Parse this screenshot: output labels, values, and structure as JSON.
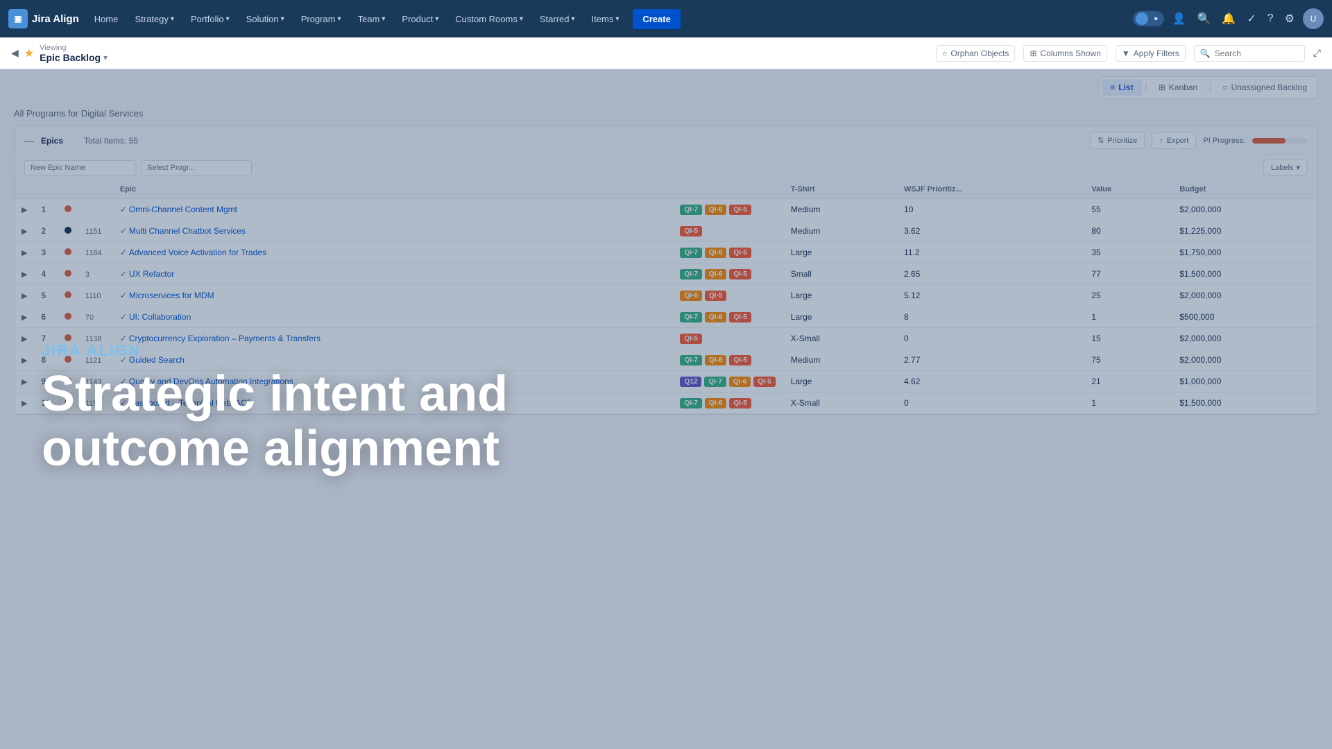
{
  "app": {
    "name": "Jira Align",
    "logo_letter": "JA"
  },
  "nav": {
    "items": [
      {
        "label": "Home",
        "has_dropdown": false
      },
      {
        "label": "Strategy",
        "has_dropdown": true
      },
      {
        "label": "Portfolio",
        "has_dropdown": true
      },
      {
        "label": "Solution",
        "has_dropdown": true
      },
      {
        "label": "Program",
        "has_dropdown": true
      },
      {
        "label": "Team",
        "has_dropdown": true
      },
      {
        "label": "Product",
        "has_dropdown": true
      },
      {
        "label": "Custom Rooms",
        "has_dropdown": true
      },
      {
        "label": "Starred",
        "has_dropdown": true
      },
      {
        "label": "Items",
        "has_dropdown": true
      }
    ],
    "create_label": "Create"
  },
  "subbar": {
    "viewing_label": "Viewing",
    "title": "Epic Backlog",
    "buttons": {
      "orphan_objects": "Orphan Objects",
      "columns_shown": "Columns Shown",
      "apply_filters": "Apply Filters",
      "search_placeholder": "Search"
    }
  },
  "view_tabs": [
    {
      "label": "List",
      "icon": "≡",
      "active": true
    },
    {
      "label": "Kanban",
      "icon": "⊞",
      "active": false
    },
    {
      "label": "Unassigned Backlog",
      "icon": "○",
      "active": false
    }
  ],
  "program": {
    "title": "All Programs for Digital Services"
  },
  "table": {
    "epics_label": "Epics",
    "total_items": "Total Items: 55",
    "new_epic_placeholder": "New Epic Name",
    "product_program_placeholder": "Select Progr...",
    "pi_progress_label": "PI Progress:",
    "prioritize_label": "Prioritize",
    "export_label": "Export",
    "labels_label": "Labels",
    "columns": [
      "",
      "",
      "",
      "",
      "Epic",
      "",
      "T-Shirt",
      "WSJF Prioritiz...",
      "Value",
      "Budget"
    ],
    "rows": [
      {
        "num": 1,
        "dot_color": "#e05c3a",
        "id": "",
        "name": "Omni-Channel Content Mgmt",
        "pi_tags": [
          "QI-7",
          "QI-6",
          "QI-5"
        ],
        "tshirt": "Medium",
        "wsjf": "10",
        "value": "55",
        "budget": "$2,000,000",
        "extra_tag": null
      },
      {
        "num": 2,
        "dot_color": "#172b4d",
        "id": "1151",
        "name": "Multi Channel Chatbot Services",
        "pi_tags": [
          "QI-5"
        ],
        "tshirt": "Medium",
        "wsjf": "3.62",
        "value": "80",
        "budget": "$1,225,000",
        "extra_tag": null
      },
      {
        "num": 3,
        "dot_color": "#e05c3a",
        "id": "1184",
        "name": "Advanced Voice Activation for Trades",
        "pi_tags": [
          "QI-7",
          "QI-6",
          "QI-5"
        ],
        "tshirt": "Large",
        "wsjf": "11.2",
        "value": "35",
        "budget": "$1,750,000",
        "extra_tag": null
      },
      {
        "num": 4,
        "dot_color": "#e05c3a",
        "id": "3",
        "name": "UX Refactor",
        "pi_tags": [
          "QI-7",
          "QI-6",
          "QI-5"
        ],
        "tshirt": "Small",
        "wsjf": "2.65",
        "value": "77",
        "budget": "$1,500,000",
        "extra_tag": null
      },
      {
        "num": 5,
        "dot_color": "#e05c3a",
        "id": "1110",
        "name": "Microservices for MDM",
        "pi_tags": [
          "QI-6",
          "QI-5"
        ],
        "tshirt": "Large",
        "wsjf": "5.12",
        "value": "25",
        "budget": "$2,000,000",
        "extra_tag": null
      },
      {
        "num": 6,
        "dot_color": "#e05c3a",
        "id": "70",
        "name": "UI: Collaboration",
        "pi_tags": [
          "QI-7",
          "QI-6",
          "QI-5"
        ],
        "tshirt": "Large",
        "wsjf": "8",
        "value": "1",
        "budget": "$500,000",
        "extra_tag": null
      },
      {
        "num": 7,
        "dot_color": "#e05c3a",
        "id": "1138",
        "name": "Cryptocurrency Exploration – Payments & Transfers",
        "pi_tags": [
          "QI-5"
        ],
        "tshirt": "X-Small",
        "wsjf": "0",
        "value": "15",
        "budget": "$2,000,000",
        "extra_tag": null
      },
      {
        "num": 8,
        "dot_color": "#e05c3a",
        "id": "1121",
        "name": "Guided Search",
        "pi_tags": [
          "QI-7",
          "QI-6",
          "QI-5"
        ],
        "tshirt": "Medium",
        "wsjf": "2.77",
        "value": "75",
        "budget": "$2,000,000",
        "extra_tag": null
      },
      {
        "num": 9,
        "dot_color": "#e05c3a",
        "id": "1143",
        "name": "Quality and DevOps Automation Integrations",
        "pi_tags": [
          "QI-7",
          "QI-6",
          "QI-5"
        ],
        "tshirt": "Large",
        "wsjf": "4.62",
        "value": "21",
        "budget": "$1,000,000",
        "extra_tag": "Q12"
      },
      {
        "num": 10,
        "dot_color": "#e05c3a",
        "id": "1150",
        "name": "Dashboard – Technical Debt AC5",
        "pi_tags": [
          "QI-7",
          "QI-6",
          "QI-5"
        ],
        "tshirt": "X-Small",
        "wsjf": "0",
        "value": "1",
        "budget": "$1,500,000",
        "extra_tag": null
      }
    ]
  },
  "overlay": {
    "subtitle": "JIRA ALIGN",
    "heading": "Strategic intent and\noutcome alignment"
  }
}
